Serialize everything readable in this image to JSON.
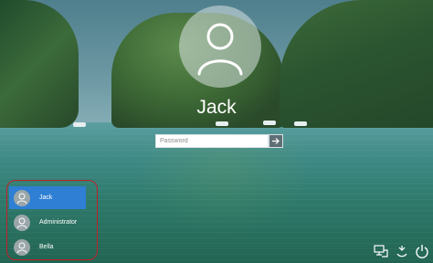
{
  "login": {
    "username": "Jack",
    "password_placeholder": "Password"
  },
  "users": [
    {
      "name": "Jack",
      "selected": true
    },
    {
      "name": "Administrator",
      "selected": false
    },
    {
      "name": "Bella",
      "selected": false
    }
  ],
  "icons": {
    "submit": "arrow-right-icon",
    "network": "network-icon",
    "accessibility": "ease-of-access-icon",
    "power": "power-icon"
  },
  "colors": {
    "selected_user": "#2f7fd4",
    "highlight_border": "#c0202a"
  }
}
